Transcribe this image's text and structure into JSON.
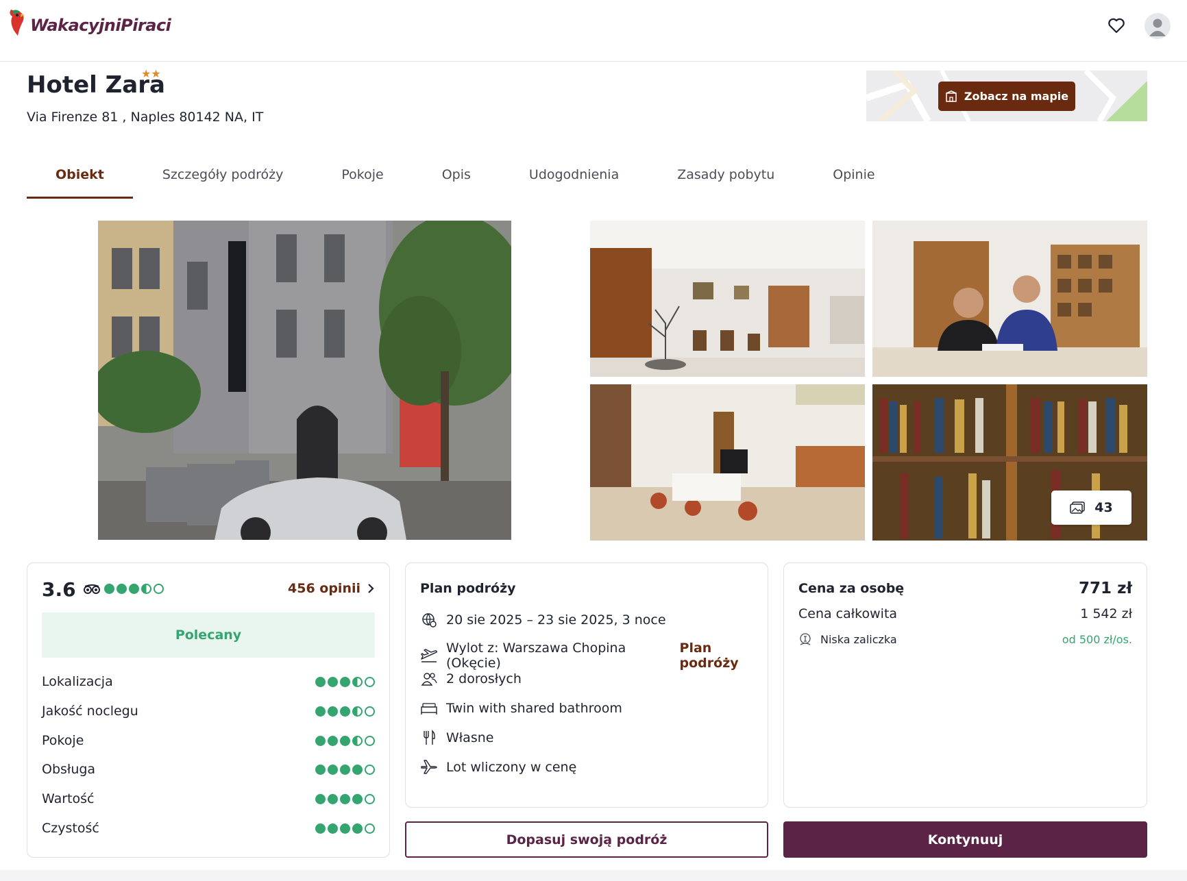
{
  "brand": {
    "name": "WakacyjniPiraci",
    "color": "#5b2346"
  },
  "header": {
    "icons": [
      "heart-icon",
      "user-icon"
    ]
  },
  "hotel": {
    "name": "Hotel Zara",
    "stars": "★★",
    "star_count": 2,
    "address": "Via Firenze 81 , Naples 80142 NA, IT"
  },
  "map": {
    "button_label": "Zobacz na mapie"
  },
  "tabs": [
    {
      "label": "Obiekt",
      "active": true
    },
    {
      "label": "Szczegóły podróży"
    },
    {
      "label": "Pokoje"
    },
    {
      "label": "Opis"
    },
    {
      "label": "Udogodnienia"
    },
    {
      "label": "Zasady pobytu"
    },
    {
      "label": "Opinie"
    }
  ],
  "gallery": {
    "photo_count": "43"
  },
  "rating": {
    "score": "3.6",
    "score_dots": 3.5,
    "reviews_label": "456 opinii",
    "badge": "Polecany",
    "criteria": [
      {
        "label": "Lokalizacja",
        "value": 3.5
      },
      {
        "label": "Jakość noclegu",
        "value": 3.5
      },
      {
        "label": "Pokoje",
        "value": 3.5
      },
      {
        "label": "Obsługa",
        "value": 4
      },
      {
        "label": "Wartość",
        "value": 4
      },
      {
        "label": "Czystość",
        "value": 4
      }
    ]
  },
  "plan": {
    "title": "Plan podróży",
    "dates": "20 sie 2025 – 23 sie 2025, 3 noce",
    "departure": "Wylot z: Warszawa Chopina (Okęcie)",
    "plan_link": "Plan podróży",
    "guests": "2 dorosłych",
    "room": "Twin with shared bathroom",
    "board": "Własne",
    "flight": "Lot wliczony w cenę"
  },
  "price": {
    "per_person_label": "Cena za osobę",
    "per_person_value": "771 zł",
    "total_label": "Cena całkowita",
    "total_value": "1 542 zł",
    "deposit_label": "Niska zaliczka",
    "deposit_value": "od 500 zł/os."
  },
  "actions": {
    "customize_label": "Dopasuj swoją podróż",
    "continue_label": "Kontynuuj"
  },
  "colors": {
    "accent": "#6a2a0f",
    "primary": "#5b2346",
    "rating_green": "#34a56f"
  }
}
